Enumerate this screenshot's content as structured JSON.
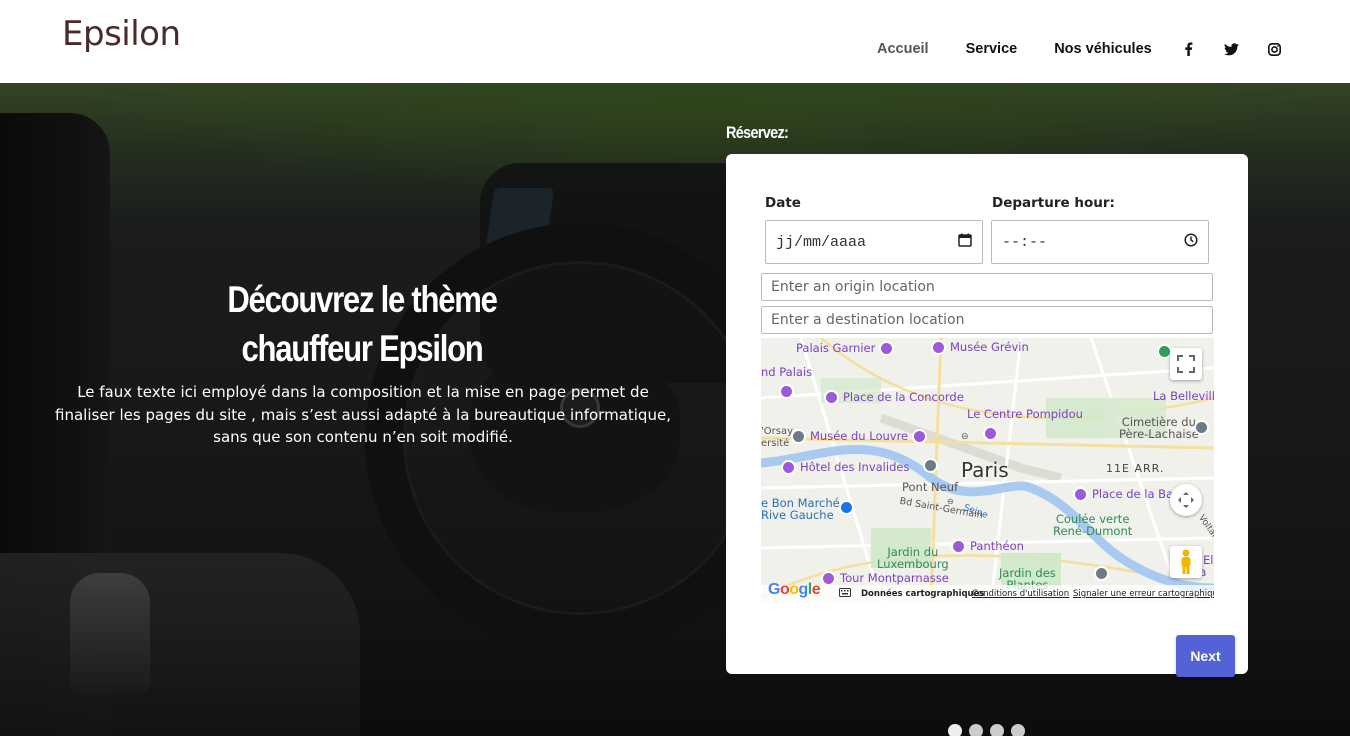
{
  "header": {
    "logo": "Epsilon",
    "nav": {
      "home": "Accueil",
      "service": "Service",
      "vehicles": "Nos véhicules"
    },
    "social_icons": [
      "facebook-icon",
      "twitter-icon",
      "instagram-icon"
    ]
  },
  "hero": {
    "title_line1": "Découvrez le thème",
    "title_line2": "chauffeur Epsilon",
    "text_line1": "Le faux texte ici employé dans la composition et la mise en page permet de",
    "text_line2": "finaliser les pages du site , mais s’est aussi adapté à la bureautique informatique,",
    "text_line3": "sans que son contenu n’en soit modifié."
  },
  "booking": {
    "heading": "Réservez:",
    "date_label": "Date",
    "date_value": "jj/mm/aaaa",
    "hour_label": "Departure hour:",
    "hour_value": "--:--",
    "origin_placeholder": "Enter an origin location",
    "destination_placeholder": "Enter a destination location",
    "next_label": "Next"
  },
  "map": {
    "city": "Paris",
    "arrondissement": "11E ARR.",
    "pois": {
      "palais_garnier": "Palais Garnier",
      "musee_grevin": "Musée Grévin",
      "grand_palais": "nd Palais",
      "concorde": "Place de la Concorde",
      "belleville": "La Bellevillois",
      "pompidou": "Le Centre Pompidou",
      "orsay1": "'Orsay",
      "orsay2": "ersité",
      "louvre": "Musée du Louvre",
      "pere1": "Cimetière du",
      "pere2": "Père-Lachaise",
      "invalides": "Hôtel des Invalides",
      "pont_neuf": "Pont Neuf",
      "bon_marche1": "e Bon Marché",
      "bon_marche2": "Rive Gauche",
      "bd_st_germain": "Bd Saint-Germain",
      "seine": "Seine",
      "bastille": "Place de la Ba",
      "coulee1": "Coulée verte",
      "coulee2": "René-Dumont",
      "voltaire": "Voltaire",
      "luxembourg1": "Jardin du",
      "luxembourg2": "Luxembourg",
      "pantheon": "Panthéon",
      "montparnasse": "Tour Montparnasse",
      "plantes1": "Jardin des",
      "plantes2": "Plantes",
      "el": "El",
      "pa": "Pa"
    },
    "footer": {
      "data": "Données cartographiques",
      "terms": "Conditions d'utilisation",
      "report": "Signaler une erreur cartographique"
    },
    "brand": "Google"
  },
  "carousel": {
    "count": 4,
    "active_index": 0
  }
}
